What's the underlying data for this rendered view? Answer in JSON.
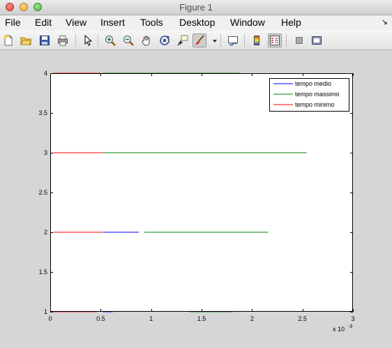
{
  "window": {
    "title": "Figure 1"
  },
  "menu": {
    "items": [
      "File",
      "Edit",
      "View",
      "Insert",
      "Tools",
      "Desktop",
      "Window",
      "Help"
    ],
    "overflow_arrow": "↘"
  },
  "toolbar": {
    "icons": [
      "new-figure-icon",
      "open-file-icon",
      "save-icon",
      "print-icon",
      "select-arrow-icon",
      "zoom-in-icon",
      "zoom-out-icon",
      "pan-hand-icon",
      "rotate-3d-icon",
      "data-cursor-icon",
      "brush-icon",
      "dropdown-arrow-icon",
      "link-plot-icon",
      "colorbar-icon",
      "legend-icon",
      "hide-plot-tools-icon",
      "show-plot-tools-icon"
    ]
  },
  "chart_data": {
    "type": "line",
    "xlim": [
      0,
      0.003
    ],
    "ylim": [
      1,
      4
    ],
    "x_ticks": [
      0,
      0.0005,
      0.001,
      0.0015,
      0.002,
      0.0025,
      0.003
    ],
    "x_tick_labels": [
      "0",
      "0.5",
      "1",
      "1.5",
      "2",
      "2.5",
      "3"
    ],
    "x_multiplier_label": "x 10",
    "x_multiplier_exponent": "-3",
    "y_ticks": [
      1,
      1.5,
      2,
      2.5,
      3,
      3.5,
      4
    ],
    "y_tick_labels": [
      "1",
      "1.5",
      "2",
      "2.5",
      "3",
      "3.5",
      "4"
    ],
    "grid": false,
    "legend_position": "top-right",
    "series": [
      {
        "name": "tempo medio",
        "color": "#0000ff",
        "segments": [
          {
            "x": [
              0.00052,
              0.00088
            ],
            "y": [
              2,
              2
            ]
          },
          {
            "x": [
              0.00052,
              0.00062
            ],
            "y": [
              1,
              1
            ]
          }
        ]
      },
      {
        "name": "tempo massimo",
        "color": "#008000",
        "segments": [
          {
            "x": [
              0.00052,
              0.00188
            ],
            "y": [
              4,
              4
            ]
          },
          {
            "x": [
              0.00052,
              0.00254
            ],
            "y": [
              3,
              3
            ]
          },
          {
            "x": [
              0.00093,
              0.00216
            ],
            "y": [
              2,
              2
            ]
          },
          {
            "x": [
              0.00138,
              0.00181
            ],
            "y": [
              1,
              1
            ]
          }
        ]
      },
      {
        "name": "tempo minimo",
        "color": "#ff0000",
        "segments": [
          {
            "x": [
              3e-05,
              0.0005
            ],
            "y": [
              4,
              4
            ]
          },
          {
            "x": [
              3e-05,
              0.00052
            ],
            "y": [
              3,
              3
            ]
          },
          {
            "x": [
              3e-05,
              0.00052
            ],
            "y": [
              2,
              2
            ]
          },
          {
            "x": [
              3e-05,
              0.00046
            ],
            "y": [
              1,
              1
            ]
          }
        ]
      }
    ]
  }
}
